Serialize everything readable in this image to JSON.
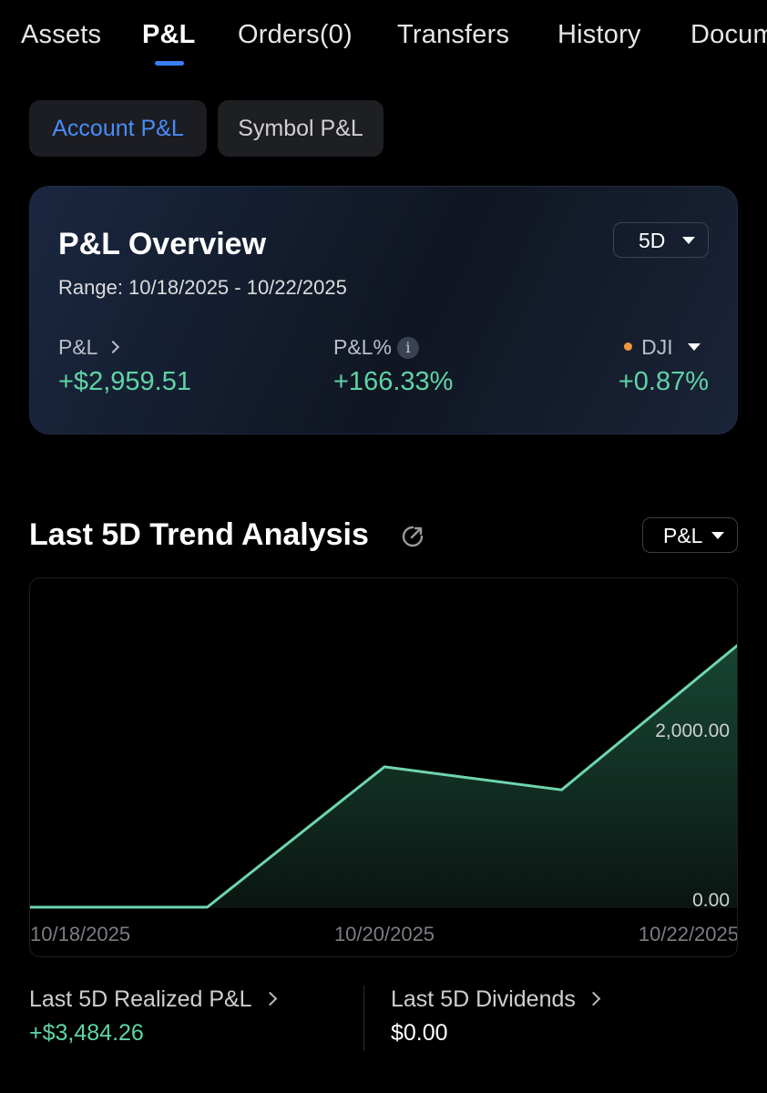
{
  "tabs": [
    {
      "label": "Assets"
    },
    {
      "label": "P&L"
    },
    {
      "label": "Orders(0)"
    },
    {
      "label": "Transfers"
    },
    {
      "label": "History"
    },
    {
      "label": "Documents"
    }
  ],
  "active_tab": "P&L",
  "segments": {
    "account": "Account P&L",
    "symbol": "Symbol P&L",
    "active": "Account P&L"
  },
  "overview": {
    "title": "P&L Overview",
    "range_selector": "5D",
    "range_text": "Range: 10/18/2025 - 10/22/2025",
    "pnl_label": "P&L",
    "pnl_value": "+$2,959.51",
    "pnl_pct_label": "P&L%",
    "pnl_pct_value": "+166.33%",
    "benchmark_label": "DJI",
    "benchmark_value": "+0.87%"
  },
  "trend": {
    "title": "Last 5D Trend Analysis",
    "metric_selector": "P&L"
  },
  "chart_data": {
    "type": "area",
    "x": [
      "10/18/2025",
      "10/19/2025",
      "10/20/2025",
      "10/21/2025",
      "10/22/2025"
    ],
    "series": [
      {
        "values": [
          0,
          0,
          1580,
          1320,
          2959.51
        ]
      }
    ],
    "x_tick_labels": [
      "10/18/2025",
      "10/20/2025",
      "10/22/2025"
    ],
    "y_tick_labels": [
      "2,000.00",
      "0.00"
    ],
    "y_ticks": [
      2000,
      0
    ],
    "ylim": [
      -10,
      3700
    ],
    "line_color": "#6fd6ae",
    "grid": false
  },
  "stats": {
    "realized_label": "Last 5D Realized P&L",
    "realized_value": "+$3,484.26",
    "dividends_label": "Last 5D Dividends",
    "dividends_value": "$0.00"
  },
  "colors": {
    "accent": "#3b7ff2",
    "positive": "#5ed4a6",
    "benchmark_dot": "#f0973a"
  }
}
